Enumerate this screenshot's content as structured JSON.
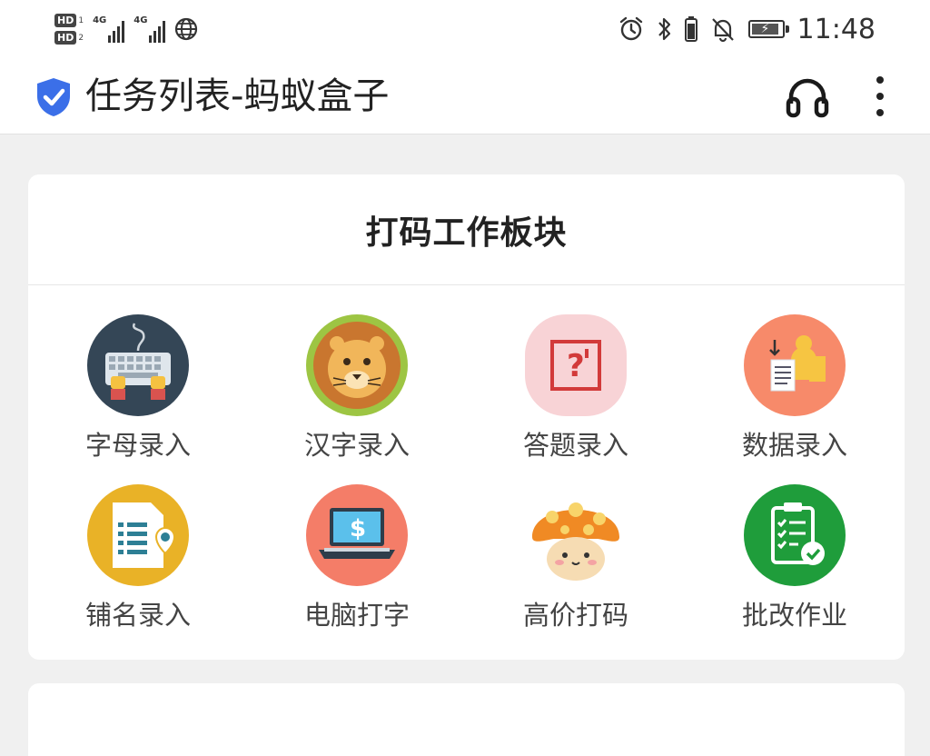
{
  "status_bar": {
    "sim1": "HD",
    "sim1_index": "1",
    "sim2": "HD",
    "sim2_index": "2",
    "network1": "4G",
    "network2": "4G",
    "time": "11:48"
  },
  "app_bar": {
    "title": "任务列表-蚂蚁盒子",
    "shield_color": "#3b6fe8"
  },
  "panel": {
    "title": "打码工作板块",
    "tasks": [
      {
        "label": "字母录入",
        "icon": "keyboard-icon"
      },
      {
        "label": "汉字录入",
        "icon": "lion-icon"
      },
      {
        "label": "答题录入",
        "icon": "question-icon"
      },
      {
        "label": "数据录入",
        "icon": "data-entry-icon"
      },
      {
        "label": "铺名录入",
        "icon": "shop-name-icon"
      },
      {
        "label": "电脑打字",
        "icon": "laptop-icon"
      },
      {
        "label": "高价打码",
        "icon": "mushroom-icon"
      },
      {
        "label": "批改作业",
        "icon": "clipboard-check-icon"
      }
    ]
  }
}
